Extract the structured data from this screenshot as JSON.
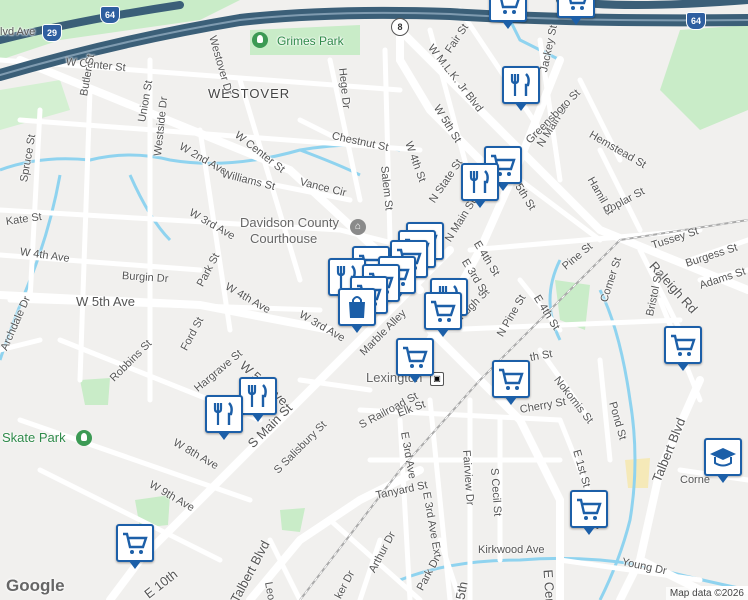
{
  "labels": {
    "westover": "WESTOVER",
    "grimes_park": "Grimes Park",
    "courthouse_1": "Davidson County",
    "courthouse_2": "Courthouse",
    "skate_park": "Skate Park",
    "lexington": "Lexington",
    "mlk": "W M.L.K. Jr Blvd",
    "w5th_top": "W 5th St",
    "e5th_top": "E 5th St",
    "n_main_st": "N Main St",
    "n_main_top": "N Main St",
    "w_center_st": "W Center St",
    "w_center_st_2": "W Center St",
    "w_2nd_ave": "W 2nd Ave",
    "w_3rd_ave": "W 3rd Ave",
    "w_3rd_ave_2": "W 3rd Ave",
    "w_4th_ave": "W 4th Ave",
    "w_4th_ave_2": "W 4th Ave",
    "w_5th_ave": "W 5th Ave",
    "w_5th_ave_2": "W 5th Ave",
    "w_8th_ave": "W 8th Ave",
    "w_9th_ave": "W 9th Ave",
    "e_10th": "E 10th",
    "s_main_st": "S Main St",
    "s_salisbury": "S Salisbury St",
    "s_railroad": "S Railroad St",
    "elk_st": "Elk St",
    "e_3rd_ave": "E 3rd Ave",
    "e_3rd_ave_ext": "E 3rd Ave Ext",
    "tanyard": "Tanyard St",
    "fairview": "Fairview Dr",
    "s_cecil": "S Cecil St",
    "kirkwood": "Kirkwood Ave",
    "young": "Young Dr",
    "talbert": "Talbert Blvd",
    "talbert_2": "Talbert Blvd",
    "raleigh": "Raleigh Rd",
    "tussey": "Tussey St",
    "burgess": "Burgess St",
    "adams": "Adams St",
    "bristol": "Bristol St",
    "comer": "Comer St",
    "pine": "Pine St",
    "n_pine": "N Pine St",
    "poplar": "Poplar St",
    "hamil": "Hamil St",
    "hemstead": "Hemstead St",
    "greensboro": "Greensboro St",
    "jackey": "Jackey St",
    "fair": "Fair St",
    "n_state": "N State St",
    "salem": "Salem St",
    "w_4th_st": "W 4th St",
    "chestnut": "Chestnut St",
    "hege": "Hege Dr",
    "vance": "Vance Cir",
    "williams": "Williams St",
    "westside": "Westside Dr",
    "union": "Union St",
    "butler": "Butler St",
    "spruce": "Spruce St",
    "kate": "Kate St",
    "burgin": "Burgin Dr",
    "park_st": "Park St",
    "ford": "Ford St",
    "robbins": "Robbins St",
    "hargrave": "Hargrave St",
    "archdale": "Archdale Dr",
    "marble": "Marble Alley",
    "pugh": "Pugh St",
    "e_4th_st": "E 4th St",
    "e_4th_st_2": "E 4th St",
    "e_3rd_st": "E 3rd St",
    "cherry": "Cherry St",
    "nokomis": "Nokomis St",
    "pond": "Pond St",
    "e_1st_st": "E 1st St",
    "arthur": "Arthur Dr",
    "leonard": "Leon",
    "westover_dr": "Westover Dr",
    "e_center": "E Cent",
    "park_dr": "Park Dr",
    "vale_ave": "lvd Ave",
    "corner": "Corne",
    "th_st": "th St",
    "ker_dr": "ker Dr",
    "r_5th": "5th",
    "ent_st": "St",
    "w_5th_mid": "W 5th"
  },
  "shields": {
    "us64_left": "64",
    "us64_right": "64",
    "us29": "29",
    "nc8": "8"
  },
  "icons": {
    "grocery": "cart-icon",
    "restaurant": "fork-knife-icon",
    "shopping": "bag-icon",
    "school": "graduation-cap-icon",
    "station": "train-icon",
    "park": "tree-icon"
  },
  "colors": {
    "pin_border": "#1c5fa8",
    "highway": "#3b5f78",
    "water": "#8fd3ef",
    "park": "#c9ecc8"
  },
  "footer": {
    "google": "Google",
    "attribution": "Map data ©2026"
  }
}
